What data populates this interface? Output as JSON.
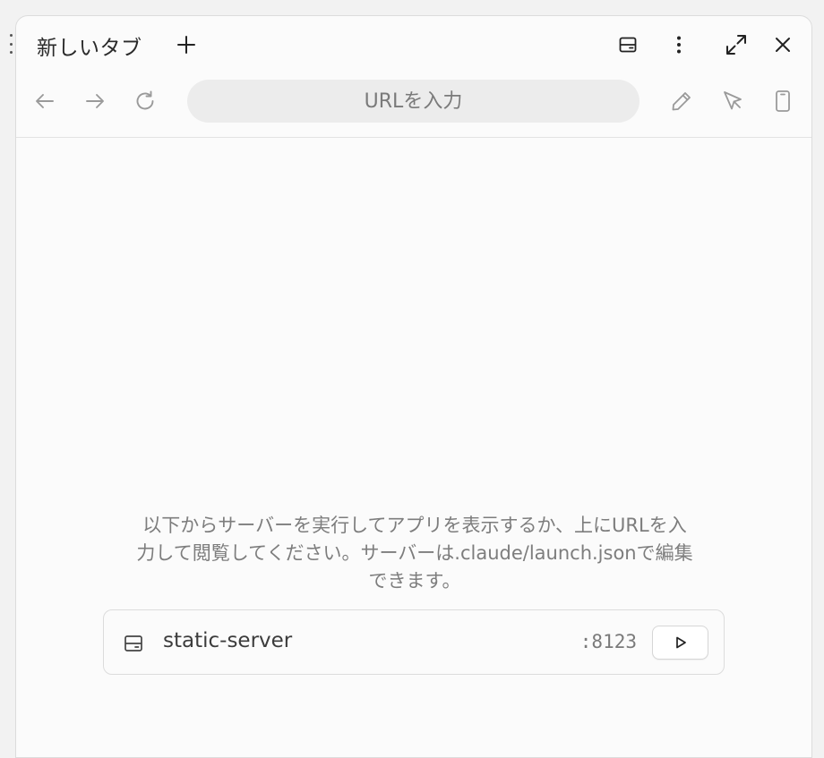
{
  "tab": {
    "title": "新しいタブ",
    "new_tab_icon": "plus-icon"
  },
  "window_controls": {
    "split_view_icon": "split-view-icon",
    "more_icon": "more-vertical-icon",
    "expand_icon": "expand-icon",
    "close_icon": "close-icon"
  },
  "navigation": {
    "back_icon": "arrow-left-icon",
    "forward_icon": "arrow-right-icon",
    "reload_icon": "reload-icon",
    "url_value": "",
    "url_placeholder": "URLを入力",
    "edit_icon": "pencil-icon",
    "select_icon": "cursor-select-icon",
    "device_icon": "mobile-device-icon"
  },
  "empty_state": {
    "message_line1": "以下からサーバーを実行してアプリを表示するか、上にURLを入",
    "message_line2": "力して閲覧してください。サーバーは.claude/launch.jsonで編集",
    "message_line3": "できます。"
  },
  "servers": [
    {
      "name": "static-server",
      "port": ":8123",
      "icon": "server-icon",
      "action_icon": "play-icon"
    }
  ],
  "colors": {
    "panel_bg": "#fbfbfb",
    "url_bar_bg": "#ececec",
    "muted_text": "#7d7d7d",
    "border": "#dcdcdc"
  }
}
